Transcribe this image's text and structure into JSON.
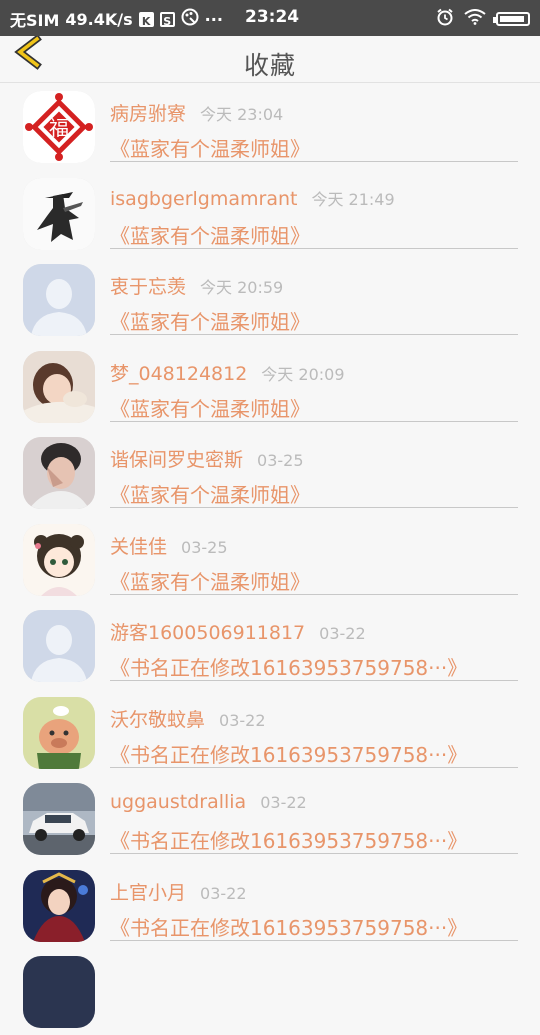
{
  "status_bar": {
    "carrier": "无SIM",
    "speed": "49.4K/s",
    "time": "23:24",
    "more": "···"
  },
  "header": {
    "title": "收藏",
    "back_icon": "chevron-left-icon",
    "accent_color": "#f0c419"
  },
  "favorites": [
    {
      "user": "病房驸寮",
      "time": "今天 23:04",
      "book": "《蓝家有个温柔师姐》",
      "avatar": "fu-papercut"
    },
    {
      "user": "isagbgerlgmamrant",
      "time": "今天 21:49",
      "book": "《蓝家有个温柔师姐》",
      "avatar": "dark-knight"
    },
    {
      "user": "衷于忘羡",
      "time": "今天 20:59",
      "book": "《蓝家有个温柔师姐》",
      "avatar": "default-user"
    },
    {
      "user": "梦_048124812",
      "time": "今天 20:09",
      "book": "《蓝家有个温柔师姐》",
      "avatar": "girl-photo"
    },
    {
      "user": "谐保间罗史密斯",
      "time": "03-25",
      "book": "《蓝家有个温柔师姐》",
      "avatar": "boy-photo"
    },
    {
      "user": "关佳佳",
      "time": "03-25",
      "book": "《蓝家有个温柔师姐》",
      "avatar": "anime-girl"
    },
    {
      "user": "游客1600506911817",
      "time": "03-22",
      "book": "《书名正在修改16163953759758···》",
      "avatar": "default-user"
    },
    {
      "user": "沃尔敬蚊鼻",
      "time": "03-22",
      "book": "《书名正在修改16163953759758···》",
      "avatar": "cartoon-pig"
    },
    {
      "user": "uggaustdrallia",
      "time": "03-22",
      "book": "《书名正在修改16163953759758···》",
      "avatar": "white-car"
    },
    {
      "user": "上官小月",
      "time": "03-22",
      "book": "《书名正在修改16163953759758···》",
      "avatar": "game-character"
    }
  ]
}
